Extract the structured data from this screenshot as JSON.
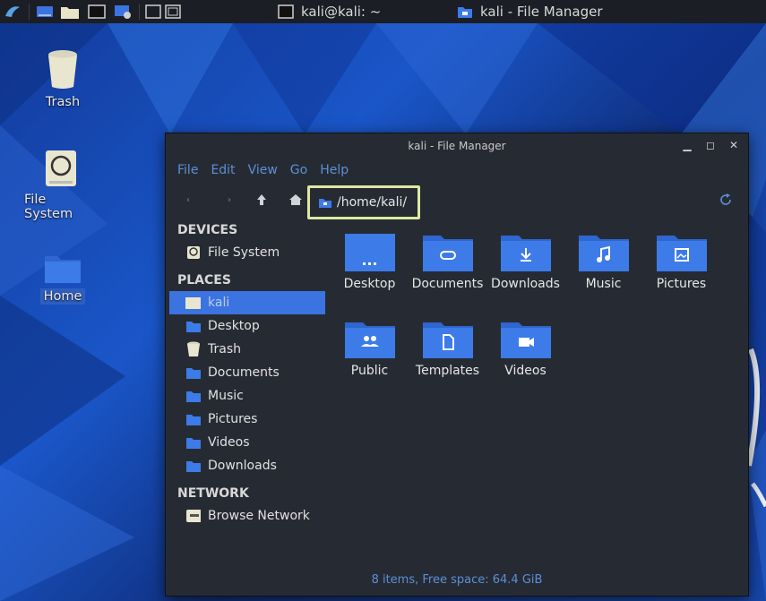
{
  "panel": {
    "tasks": [
      {
        "icon": "terminal-icon",
        "label": "kali@kali: ~"
      },
      {
        "icon": "home-folder-icon",
        "label": "kali - File Manager"
      }
    ]
  },
  "desktop": {
    "icons": [
      {
        "name": "trash",
        "label": "Trash",
        "icon": "trash-icon"
      },
      {
        "name": "file-system",
        "label": "File System",
        "icon": "drive-icon"
      },
      {
        "name": "home",
        "label": "Home",
        "icon": "home-folder-icon"
      }
    ]
  },
  "window": {
    "title": "kali - File Manager",
    "menu": [
      "File",
      "Edit",
      "View",
      "Go",
      "Help"
    ],
    "path": "/home/kali/",
    "sidebar": {
      "devices_header": "DEVICES",
      "devices": [
        {
          "label": "File System",
          "icon": "drive-icon"
        }
      ],
      "places_header": "PLACES",
      "places": [
        {
          "label": "kali",
          "icon": "home-folder-icon",
          "active": true
        },
        {
          "label": "Desktop",
          "icon": "desktop-folder-icon"
        },
        {
          "label": "Trash",
          "icon": "trash-icon"
        },
        {
          "label": "Documents",
          "icon": "documents-folder-icon"
        },
        {
          "label": "Music",
          "icon": "music-folder-icon"
        },
        {
          "label": "Pictures",
          "icon": "pictures-folder-icon"
        },
        {
          "label": "Videos",
          "icon": "videos-folder-icon"
        },
        {
          "label": "Downloads",
          "icon": "downloads-folder-icon"
        }
      ],
      "network_header": "NETWORK",
      "network": [
        {
          "label": "Browse Network",
          "icon": "network-icon"
        }
      ]
    },
    "files": [
      {
        "label": "Desktop",
        "icon": "desktop-folder-icon"
      },
      {
        "label": "Documents",
        "icon": "documents-folder-icon"
      },
      {
        "label": "Downloads",
        "icon": "downloads-folder-icon"
      },
      {
        "label": "Music",
        "icon": "music-folder-icon"
      },
      {
        "label": "Pictures",
        "icon": "pictures-folder-icon"
      },
      {
        "label": "Public",
        "icon": "public-folder-icon"
      },
      {
        "label": "Templates",
        "icon": "templates-folder-icon"
      },
      {
        "label": "Videos",
        "icon": "videos-folder-icon"
      }
    ],
    "status": "8 items, Free space: 64.4 GiB"
  },
  "colors": {
    "accent": "#3b73e0",
    "folder": "#3d7be8",
    "menu_text": "#5c8fd6",
    "highlight_box": "#dfe8a2"
  }
}
